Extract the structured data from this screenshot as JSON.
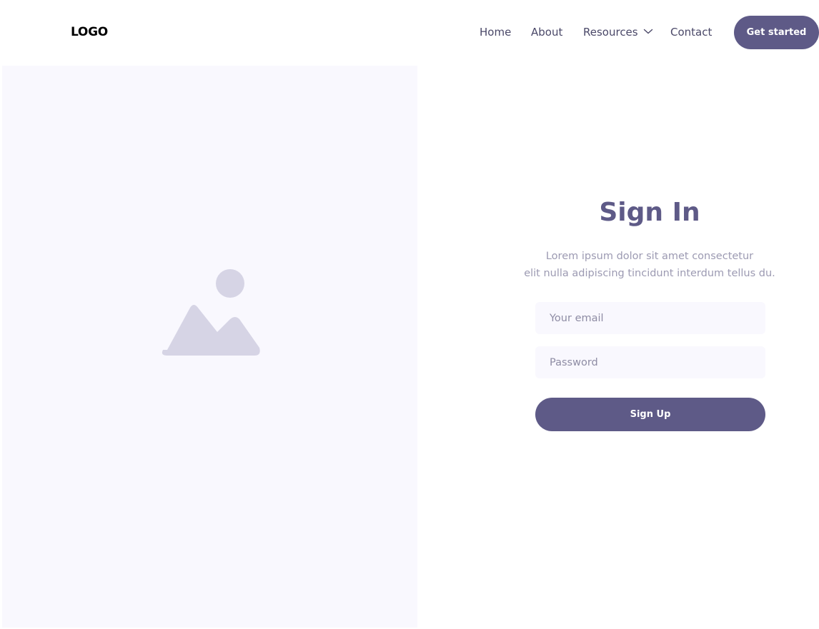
{
  "header": {
    "logo": "LOGO",
    "nav": [
      {
        "label": "Home"
      },
      {
        "label": "About"
      },
      {
        "label": "Resources",
        "icon": "chevron-down-icon"
      },
      {
        "label": "Contact"
      }
    ],
    "cta_label": "Get started"
  },
  "image_panel": {
    "icon": "image-placeholder-icon"
  },
  "signin": {
    "title": "Sign In",
    "description_line1": "Lorem ipsum dolor sit amet consectetur",
    "description_line2": "elit nulla adipiscing tincidunt interdum tellus du.",
    "email_placeholder": "Your email",
    "email_value": "",
    "password_placeholder": "Password",
    "password_value": "",
    "submit_label": "Sign Up"
  },
  "colors": {
    "accent": "#5e5a87",
    "panel_background": "#f9f8fe",
    "placeholder_shape": "#d6d4e5",
    "nav_text": "#4a4868",
    "muted_text": "#9c9ab2"
  }
}
